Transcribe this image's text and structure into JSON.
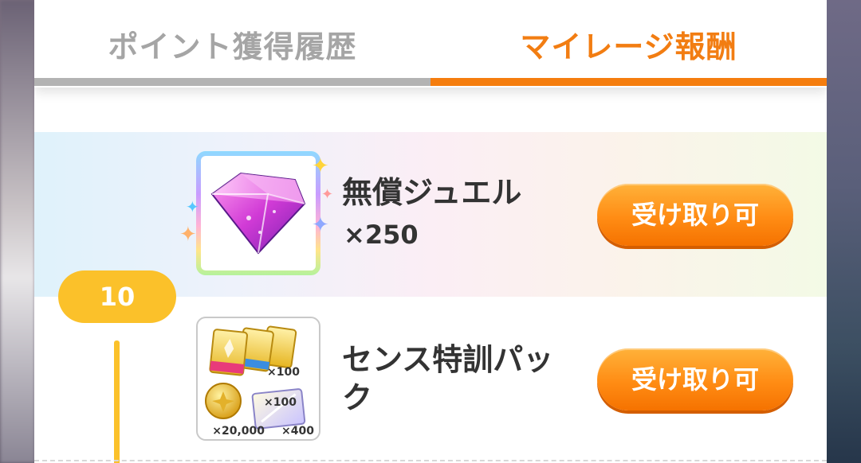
{
  "tabs": [
    {
      "label": "ポイント獲得履歴",
      "active": false
    },
    {
      "label": "マイレージ報酬",
      "active": true
    }
  ],
  "level": "10",
  "rewards": [
    {
      "name": "無償ジュエル",
      "quantity": "×250",
      "button_label": "受け取り可",
      "icon": "jewel-icon"
    },
    {
      "name_line1": "センス特訓パッ",
      "name_line2": "ク",
      "button_label": "受け取り可",
      "icon": "training-pack-icon",
      "pack_labels": {
        "top": "×100",
        "coin": "×20,000",
        "mid": "×100",
        "bottom": "×400"
      }
    }
  ],
  "colors": {
    "accent": "#f27d12",
    "level_pill": "#fbc12a",
    "button": "#ff8c14"
  }
}
